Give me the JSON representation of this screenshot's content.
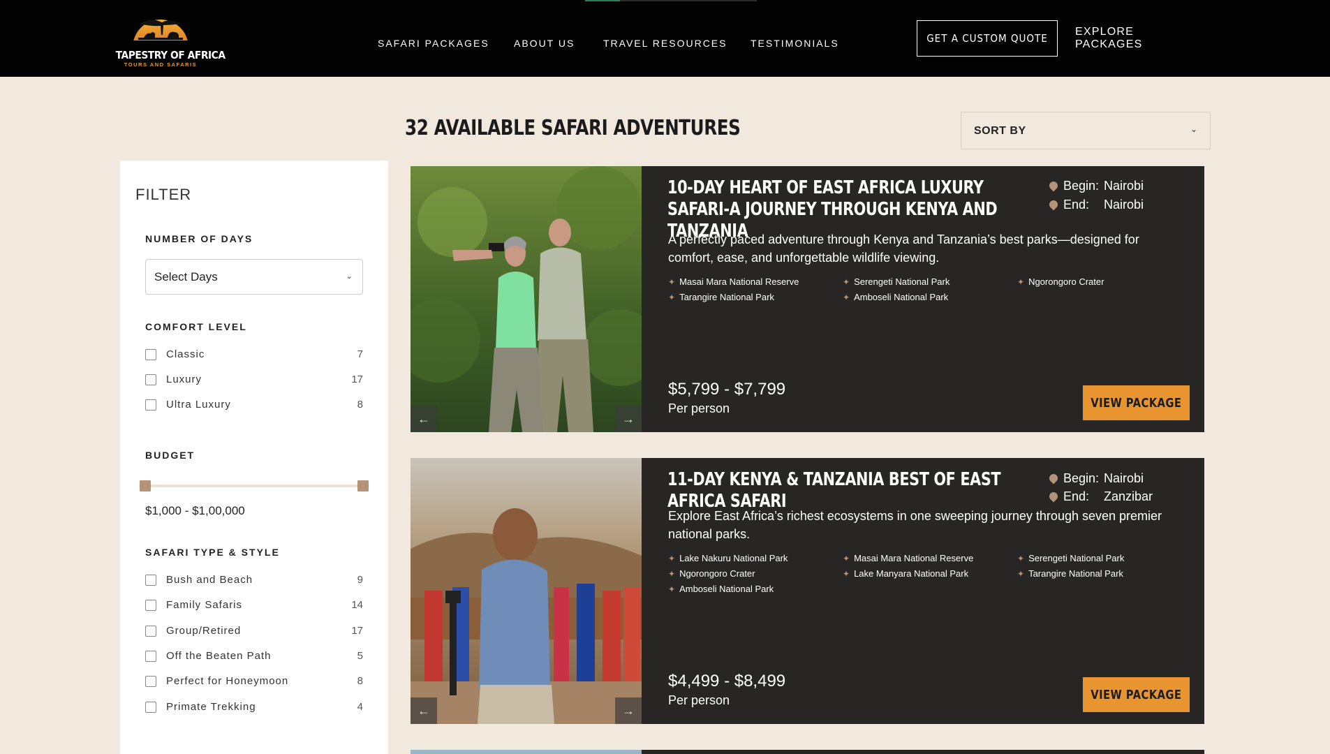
{
  "brand": {
    "name": "TAPESTRY OF AFRICA",
    "tagline": "TOURS AND SAFARIS"
  },
  "nav": {
    "items": [
      "SAFARI PACKAGES",
      "ABOUT US",
      "TRAVEL RESOURCES",
      "TESTIMONIALS"
    ],
    "quote_button": "GET A CUSTOM QUOTE",
    "explore_link": "EXPLORE PACKAGES"
  },
  "results": {
    "heading": "32 AVAILABLE SAFARI ADVENTURES",
    "sort_label": "SORT BY"
  },
  "filter": {
    "title": "FILTER",
    "days": {
      "label": "NUMBER OF DAYS",
      "placeholder": "Select Days"
    },
    "comfort": {
      "label": "COMFORT LEVEL",
      "options": [
        {
          "label": "Classic",
          "count": "7"
        },
        {
          "label": "Luxury",
          "count": "17"
        },
        {
          "label": "Ultra Luxury",
          "count": "8"
        }
      ]
    },
    "budget": {
      "label": "BUDGET",
      "range": "$1,000 - $1,00,000"
    },
    "type": {
      "label": "SAFARI TYPE & STYLE",
      "options": [
        {
          "label": "Bush and Beach",
          "count": "9"
        },
        {
          "label": "Family Safaris",
          "count": "14"
        },
        {
          "label": "Group/Retired",
          "count": "17"
        },
        {
          "label": "Off the Beaten Path",
          "count": "5"
        },
        {
          "label": "Perfect for Honeymoon",
          "count": "8"
        },
        {
          "label": "Primate Trekking",
          "count": "4"
        }
      ]
    }
  },
  "packages": [
    {
      "title": "10-DAY HEART OF EAST AFRICA LUXURY SAFARI-A JOURNEY THROUGH KENYA AND TANZANIA",
      "begin_label": "Begin:",
      "begin": "Nairobi",
      "end_label": "End:",
      "end": "Nairobi",
      "description": "A perfectly paced adventure through Kenya and Tanzania’s best parks—designed for comfort, ease, and unforgettable wildlife viewing.",
      "parks": [
        "Masai Mara National Reserve",
        "Serengeti National Park",
        "Ngorongoro Crater",
        "Tarangire National Park",
        "Amboseli National Park"
      ],
      "price": "$5,799 - $7,799",
      "per": "Per person",
      "button": "VIEW PACKAGE"
    },
    {
      "title": "11-DAY KENYA & TANZANIA BEST OF EAST AFRICA SAFARI",
      "begin_label": "Begin:",
      "begin": "Nairobi",
      "end_label": "End:",
      "end": "Zanzibar",
      "description": "Explore East Africa’s richest ecosystems in one sweeping journey through seven premier national parks.",
      "parks": [
        "Lake Nakuru National Park",
        "Masai Mara National Reserve",
        "Serengeti National Park",
        "Ngorongoro Crater",
        "Lake Manyara National Park",
        "Tarangire National Park",
        "Amboseli National Park"
      ],
      "price": "$4,499 - $8,499",
      "per": "Per person",
      "button": "VIEW PACKAGE"
    }
  ],
  "colors": {
    "accent": "#e8952f",
    "card_bg": "#282624",
    "page_bg": "#f1e8de",
    "header_bg": "#020202",
    "muted_tan": "#b59378"
  }
}
